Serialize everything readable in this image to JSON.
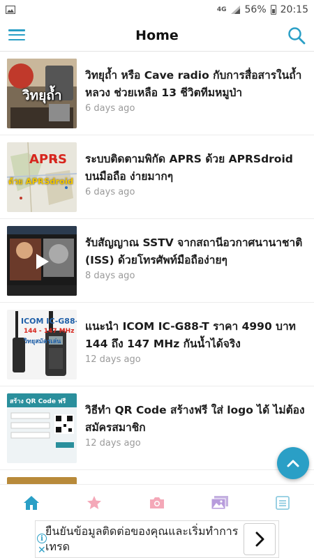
{
  "status_bar": {
    "network": "4G",
    "battery": "56%",
    "time": "20:15",
    "icons": [
      "gallery-notification-icon",
      "signal-icon",
      "battery-icon"
    ]
  },
  "app_bar": {
    "title": "Home",
    "icons": [
      "menu-icon",
      "search-icon"
    ]
  },
  "feed": {
    "items": [
      {
        "title": "วิทยุถ้ำ หรือ Cave radio กับการสื่อสารในถ้ำหลวง ช่วยเหลือ 13 ชีวิตทีมหมูป่า",
        "time": "6 days ago",
        "thumb_text": "วิทยุถ้ำ"
      },
      {
        "title": "ระบบติดตามพิกัด APRS ด้วย APRSdroid บนมือถือ ง่ายมากๆ",
        "time": "6 days ago",
        "thumb_text": "APRS",
        "thumb_text2": "ด้วย APRSdroid"
      },
      {
        "title": "รับสัญญาณ SSTV จากสถานีอวกาศนานาชาติ (ISS) ด้วยโทรศัพท์มือถือง่ายๆ",
        "time": "8 days ago",
        "thumb_text": ""
      },
      {
        "title": "แนะนำ ICOM IC-G88-T ราคา 4990 บาท 144 ถึง 147 MHz กันน้ำได้จริง",
        "time": "12 days ago",
        "thumb_text": "ICOM IC-G88-T",
        "thumb_text2": "144 - 147 MHz",
        "thumb_text3": "วิทยุสมัครเล่น"
      },
      {
        "title": "วิธีทำ QR Code สร้างฟรี ใส่ logo ได้ ไม่ต้องสมัครสมาชิก",
        "time": "12 days ago",
        "thumb_text": "สร้าง QR Code ฟรี"
      }
    ]
  },
  "bottom_nav": {
    "items": [
      "home-icon",
      "star-icon",
      "camera-icon",
      "images-icon",
      "list-icon"
    ],
    "active_color": "#2a9fc6"
  },
  "ad": {
    "text": "ยืนยันข้อมูลติดต่อของคุณและเริ่มทำการเทรด",
    "info_symbol": "i",
    "close_symbol": "✕",
    "icons": [
      "ad-info-icon",
      "ad-close-icon",
      "chevron-right-icon"
    ]
  },
  "colors": {
    "accent": "#2a9fc6"
  }
}
